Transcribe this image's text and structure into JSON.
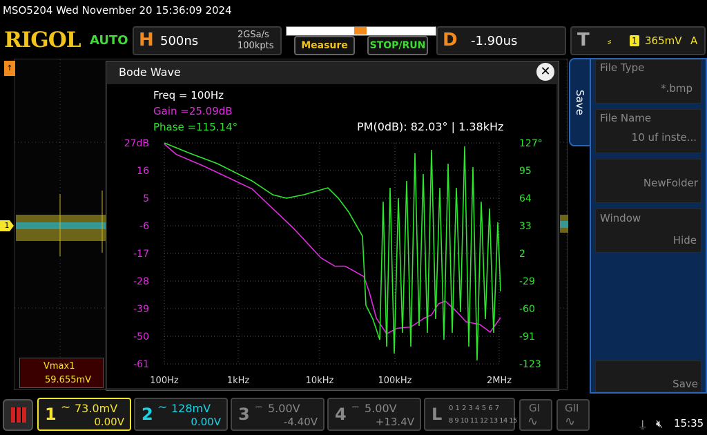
{
  "header": {
    "title": "MSO5204  Wed November 20 15:36:09 2024",
    "brand": "RIGOL",
    "mode": "AUTO",
    "horizontal": {
      "letter": "H",
      "timebase": "500ns",
      "rate": "2GSa/s",
      "depth": "100kpts"
    },
    "measure_label": "Measure",
    "stop_run_label": "STOP/RUN",
    "delay": {
      "letter": "D",
      "value": "-1.90us"
    },
    "trigger": {
      "letter": "T",
      "source": "1",
      "level": "365mV",
      "coupling": "A"
    }
  },
  "left_marker": "1",
  "vmax": {
    "label": "Vmax1",
    "value": "59.655mV"
  },
  "dialog": {
    "title": "Bode Wave",
    "close_icon": "close-icon",
    "readout": {
      "freq": "Freq = 100Hz",
      "gain": "Gain =25.09dB",
      "phase": "Phase =115.14°"
    },
    "pm": "PM(0dB):  82.03° | 1.38kHz",
    "gain_ticks": [
      "27dB",
      "16",
      "5",
      "-6",
      "-17",
      "-28",
      "-39",
      "-50",
      "-61"
    ],
    "phase_ticks": [
      "127°",
      "95",
      "64",
      "33",
      "2",
      "-29",
      "-60",
      "-91",
      "-123"
    ],
    "freq_ticks": [
      "100Hz",
      "1kHz",
      "10kHz",
      "100kHz",
      "2MHz"
    ]
  },
  "side_panel": {
    "tab_label": "Save",
    "file_type": {
      "label": "File Type",
      "value": "*.bmp"
    },
    "file_name": {
      "label": "File Name",
      "value": "10 uf inste..."
    },
    "new_folder": "NewFolder",
    "window": {
      "label": "Window",
      "value": "Hide"
    },
    "save_button": "Save"
  },
  "channels": [
    {
      "num": "1",
      "scale": "73.0mV",
      "offset": "0.00V",
      "color": "#f5e62b"
    },
    {
      "num": "2",
      "scale": "128mV",
      "offset": "0.00V",
      "color": "#1ad3e6"
    },
    {
      "num": "3",
      "scale": "5.00V",
      "offset": "-4.40V",
      "color": "#888888"
    },
    {
      "num": "4",
      "scale": "5.00V",
      "offset": "+13.4V",
      "color": "#888888"
    }
  ],
  "logic": {
    "letter": "L",
    "row1": "0 1 2 3  4 5 6 7",
    "row2": "8 9 10 11 12 13 14 15"
  },
  "gen1": "GI",
  "gen2": "GII",
  "status": {
    "time": "15:35",
    "usb_icon": "usb-icon",
    "speaker_icon": "mute-icon"
  },
  "colors": {
    "gain": "#e02ce0",
    "phase": "#2ee62e",
    "accent": "#f28a1e"
  }
}
